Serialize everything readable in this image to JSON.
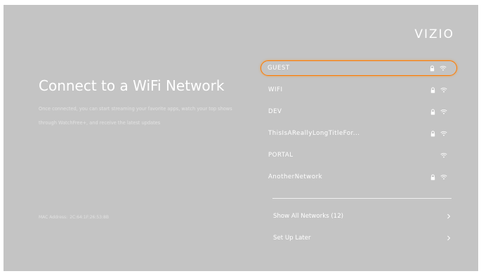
{
  "brand": {
    "logo_text": "VIZIO"
  },
  "intro": {
    "title": "Connect to a WiFi Network",
    "description": "Once connected, you can start streaming your favorite apps, watch your top shows through WatchFree+, and receive the latest updates",
    "mac_label": "MAC Address:",
    "mac_value": "2C:64:1F:26:53:8B"
  },
  "networks": [
    {
      "name": "GUEST",
      "locked": true,
      "selected": true
    },
    {
      "name": "WIFI",
      "locked": true,
      "selected": false
    },
    {
      "name": "DEV",
      "locked": true,
      "selected": false
    },
    {
      "name": "ThisIsAReallyLongTitleFor...",
      "locked": true,
      "selected": false
    },
    {
      "name": "PORTAL",
      "locked": false,
      "selected": false
    },
    {
      "name": "AnotherNetwork",
      "locked": true,
      "selected": false
    }
  ],
  "options": {
    "show_all": "Show All Networks (12)",
    "setup_later": "Set Up Later"
  },
  "colors": {
    "background": "#c4c4c4",
    "focus_ring": "#ff7a00",
    "text": "#ffffff"
  },
  "icons": {
    "lock": "lock-icon",
    "wifi": "wifi-icon",
    "chevron": "chevron-right-icon"
  }
}
